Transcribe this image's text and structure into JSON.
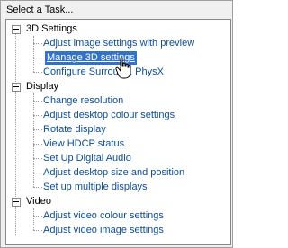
{
  "panel": {
    "title": "Select a Task..."
  },
  "tree": {
    "categories": [
      {
        "label": "3D Settings",
        "items": [
          "Adjust image settings with preview",
          "Manage 3D settings",
          "Configure Surround, PhysX"
        ]
      },
      {
        "label": "Display",
        "items": [
          "Change resolution",
          "Adjust desktop colour settings",
          "Rotate display",
          "View HDCP status",
          "Set Up Digital Audio",
          "Adjust desktop size and position",
          "Set up multiple displays"
        ]
      },
      {
        "label": "Video",
        "items": [
          "Adjust video colour settings",
          "Adjust video image settings"
        ]
      }
    ],
    "selected_item": "Manage 3D settings"
  },
  "colors": {
    "link": "#0a4d9a",
    "selection": "#3373c6"
  }
}
